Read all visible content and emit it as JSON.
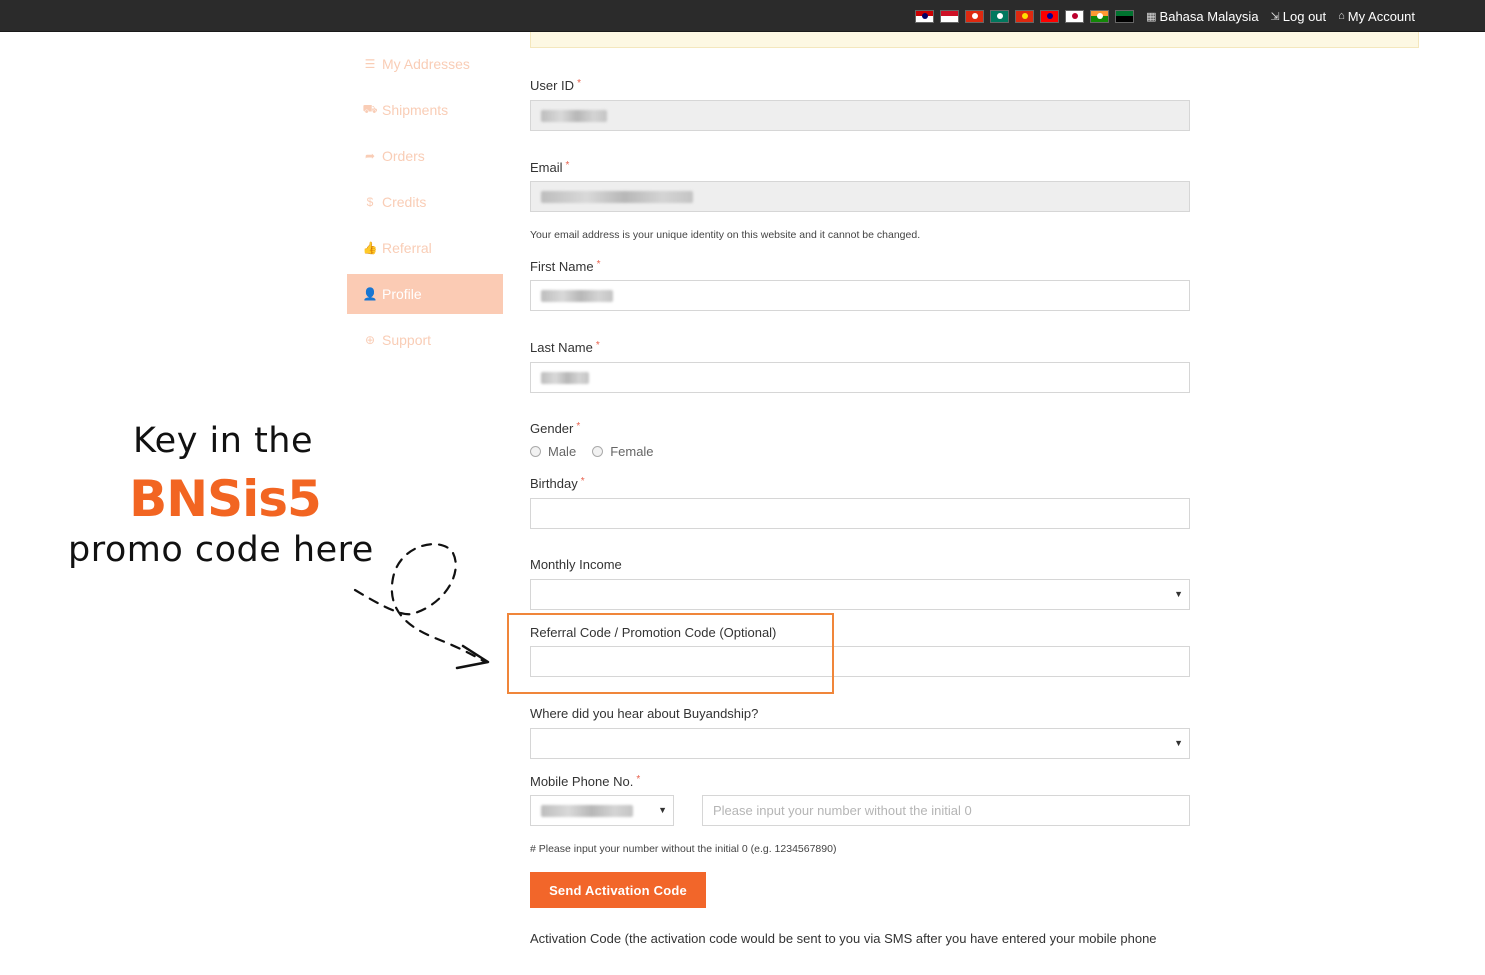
{
  "topbar": {
    "flags": [
      {
        "name": "malaysia-flag",
        "top": "#cc0001",
        "bottom": "#ffffff",
        "dot": "#010066"
      },
      {
        "name": "indonesia-flag",
        "top": "#ce1126",
        "bottom": "#ffffff",
        "dot": ""
      },
      {
        "name": "hongkong-flag",
        "top": "#de2910",
        "bottom": "#de2910",
        "dot": "#ffffff"
      },
      {
        "name": "macau-flag",
        "top": "#00785e",
        "bottom": "#00785e",
        "dot": "#ffffff"
      },
      {
        "name": "china-flag",
        "top": "#de2910",
        "bottom": "#de2910",
        "dot": "#ffde00"
      },
      {
        "name": "taiwan-flag",
        "top": "#fe0000",
        "bottom": "#fe0000",
        "dot": "#000095"
      },
      {
        "name": "japan-flag",
        "top": "#ffffff",
        "bottom": "#ffffff",
        "dot": "#bc002d"
      },
      {
        "name": "india-flag",
        "top": "#ff9933",
        "bottom": "#138808",
        "dot": "#ffffff"
      },
      {
        "name": "uae-flag",
        "top": "#00732f",
        "bottom": "#000000",
        "dot": ""
      }
    ],
    "language_label": "Bahasa Malaysia",
    "logout_label": "Log out",
    "account_label": "My Account"
  },
  "sidebar": {
    "items": [
      {
        "label": "My Addresses",
        "icon": "list-icon",
        "glyph": "☰"
      },
      {
        "label": "Shipments",
        "icon": "cart-icon",
        "glyph": "⛟"
      },
      {
        "label": "Orders",
        "icon": "share-icon",
        "glyph": "➦"
      },
      {
        "label": "Credits",
        "icon": "dollar-icon",
        "glyph": "$"
      },
      {
        "label": "Referral",
        "icon": "thumbs-up-icon",
        "glyph": "👍"
      },
      {
        "label": "Profile",
        "icon": "user-icon",
        "glyph": "👤"
      },
      {
        "label": "Support",
        "icon": "lifebuoy-icon",
        "glyph": "⊕"
      }
    ],
    "active": "Profile"
  },
  "form": {
    "user_id_label": "User ID",
    "email_label": "Email",
    "email_help": "Your email address is your unique identity on this website and it cannot be changed.",
    "first_name_label": "First Name",
    "last_name_label": "Last Name",
    "gender_label": "Gender",
    "gender_male": "Male",
    "gender_female": "Female",
    "birthday_label": "Birthday",
    "monthly_income_label": "Monthly Income",
    "referral_label": "Referral Code / Promotion Code (Optional)",
    "hear_about_label": "Where did you hear about Buyandship?",
    "mobile_label": "Mobile Phone No.",
    "mobile_placeholder": "Please input your number without the initial 0",
    "mobile_help": "# Please input your number without the initial 0 (e.g. 1234567890)",
    "send_button": "Send Activation Code",
    "activation_text": "Activation Code (the activation code would be sent to you via SMS after you have entered your mobile phone",
    "required_mark": "*"
  },
  "annotation": {
    "line1": "Key in the",
    "code": "BNSis5",
    "line3": "promo code here"
  },
  "colors": {
    "accent": "#f2662a",
    "highlight_border": "#f0863a",
    "sidebar_active": "#fbcbb4"
  }
}
